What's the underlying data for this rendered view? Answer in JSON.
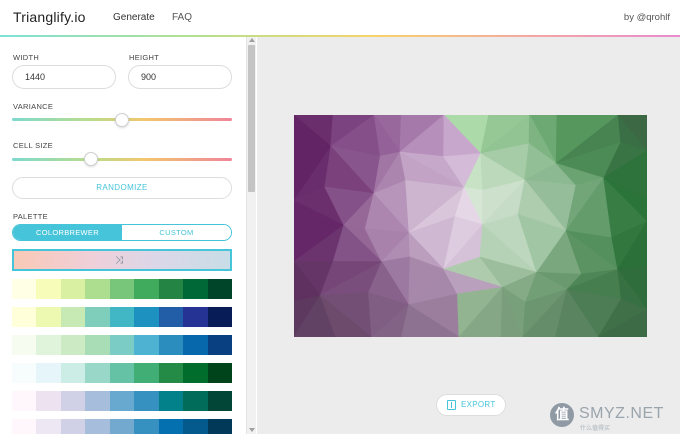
{
  "header": {
    "brand": "Trianglify.io",
    "nav": [
      "Generate",
      "FAQ"
    ],
    "author": "by @qrohlf"
  },
  "sidebar": {
    "width_label": "WIDTH",
    "width_value": "1440",
    "height_label": "HEIGHT",
    "height_value": "900",
    "variance_label": "VARIANCE",
    "variance_value": 0.5,
    "cell_size_label": "CELL SIZE",
    "cell_size_value": 0.36,
    "randomize_label": "RANDOMIZE",
    "palette_label": "PALETTE",
    "palette_tabs": [
      "COLORBREWER",
      "CUSTOM"
    ],
    "selected_palette_tab": "COLORBREWER",
    "palettes": [
      [
        "#ffffe5",
        "#f7fcb9",
        "#d9f0a3",
        "#addd8e",
        "#78c679",
        "#41ab5d",
        "#238443",
        "#006837",
        "#004529"
      ],
      [
        "#ffffd9",
        "#edf8b1",
        "#c7e9b4",
        "#7fcdbb",
        "#41b6c4",
        "#1d91c0",
        "#225ea8",
        "#253494",
        "#081d58"
      ],
      [
        "#f7fcf0",
        "#e0f3db",
        "#ccebc5",
        "#a8ddb5",
        "#7bccc4",
        "#4eb3d3",
        "#2b8cbe",
        "#0868ac",
        "#084081"
      ],
      [
        "#f7fcfd",
        "#e5f5f9",
        "#ccece6",
        "#99d8c9",
        "#66c2a4",
        "#41ae76",
        "#238b45",
        "#006d2c",
        "#00441b"
      ],
      [
        "#fff7fb",
        "#ece2f0",
        "#d0d1e6",
        "#a6bddb",
        "#67a9cf",
        "#3690c0",
        "#02818a",
        "#016c59",
        "#014636"
      ],
      [
        "#fff7fb",
        "#ece7f2",
        "#d0d1e6",
        "#a6bddb",
        "#74a9cf",
        "#3690c0",
        "#0570b0",
        "#045a8d",
        "#023858"
      ]
    ]
  },
  "main": {
    "export_label": "EXPORT",
    "preview_colors": {
      "purple_dark": "#5b1a5d",
      "purple_light": "#c9a5cf",
      "white": "#f3f0f2",
      "green_light": "#a9d9a6",
      "green_dark": "#1f6b2f",
      "gray": "#5a5a5a"
    }
  },
  "watermark": {
    "glyph": "值",
    "text": "SMYZ.NET",
    "sub": "什么值得买"
  },
  "colors": {
    "accent": "#46c4d9"
  }
}
